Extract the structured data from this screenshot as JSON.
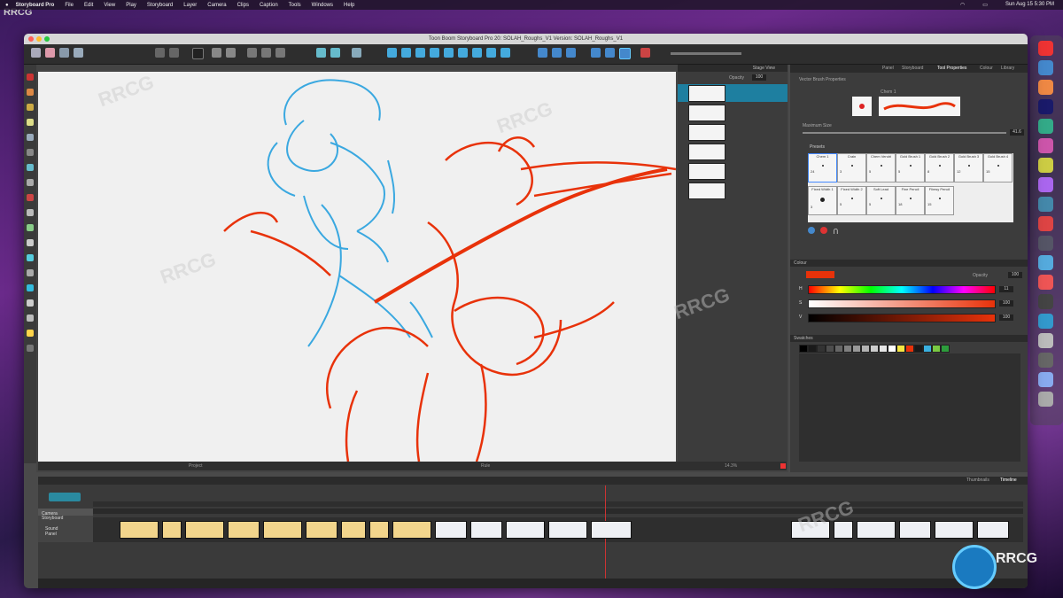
{
  "menubar": {
    "app_name": "Storyboard Pro",
    "menus": [
      "File",
      "Edit",
      "View",
      "Play",
      "Storyboard",
      "Layer",
      "Camera",
      "Clips",
      "Caption",
      "Tools",
      "Windows",
      "Help"
    ],
    "clock": "Sun Aug 15  5:30 PM"
  },
  "window": {
    "title": "Toon Boom Storyboard Pro 20: SOLAH_Roughs_V1 Version: SOLAH_Roughs_V1"
  },
  "stage_view": {
    "header": "Stage View",
    "opacity_label": "Opacity",
    "opacity_value": "100"
  },
  "right_tabs": [
    "Panel",
    "Storyboard",
    "Tool Properties",
    "Colour",
    "Library"
  ],
  "tool_properties": {
    "section": "Vector Brush Properties",
    "preset_name": "Chem 1",
    "max_size_label": "Maximum Size",
    "max_size_value": "41.6",
    "presets_header": "Presets",
    "brush_presets": [
      {
        "name": "Chem 1",
        "size": "24"
      },
      {
        "name": "Crain",
        "size": "3"
      },
      {
        "name": "Chem Vendri",
        "size": "5"
      },
      {
        "name": "Gold Brush 1",
        "size": "5"
      },
      {
        "name": "Gold Brush 2",
        "size": "8"
      },
      {
        "name": "Gold Brush 3",
        "size": "12"
      },
      {
        "name": "Gold Brush 4",
        "size": "15"
      },
      {
        "name": "Fixed Width 1",
        "size": "3"
      },
      {
        "name": "Fixed Width 2",
        "size": "5"
      },
      {
        "name": "Soft Lead",
        "size": "5"
      },
      {
        "name": "Fine Pencil",
        "size": "18"
      },
      {
        "name": "Flimsy Pencil",
        "size": "15"
      }
    ]
  },
  "colour": {
    "header": "Colour",
    "opacity_label": "Opacity",
    "opacity_value": "100",
    "h_label": "H",
    "h_value": "11",
    "s_label": "S",
    "s_value": "100",
    "v_label": "V",
    "v_value": "100",
    "current": "#e8320a"
  },
  "swatches": {
    "header": "Swatches",
    "colors": [
      "#000000",
      "#1a1a1a",
      "#333333",
      "#4d4d4d",
      "#666666",
      "#808080",
      "#999999",
      "#b3b3b3",
      "#cccccc",
      "#e6e6e6",
      "#ffffff",
      "#f5e642",
      "#e8320a",
      "#1a1a1a",
      "#3ab0e0",
      "#7ac943",
      "#2d9c3c"
    ]
  },
  "canvas_bar": {
    "left_label": "Project",
    "center_label": "Rule",
    "zoom": "14.3%"
  },
  "timeline": {
    "tabs": [
      "Thumbnails",
      "Timeline"
    ],
    "track_labels": [
      "Camera",
      "Storyboard",
      "Sound",
      "Panel"
    ],
    "frame_count": 30
  },
  "icons": {
    "tool_colors": [
      "#c33",
      "#d84",
      "#ca4",
      "#dd8",
      "#9ab",
      "#888",
      "#6bc",
      "#aaa",
      "#c44",
      "#bbb",
      "#8c8",
      "#ccc",
      "#5cd",
      "#aaa",
      "#3bd",
      "#ccc",
      "#bbb",
      "#ffd44a",
      "#777"
    ]
  }
}
